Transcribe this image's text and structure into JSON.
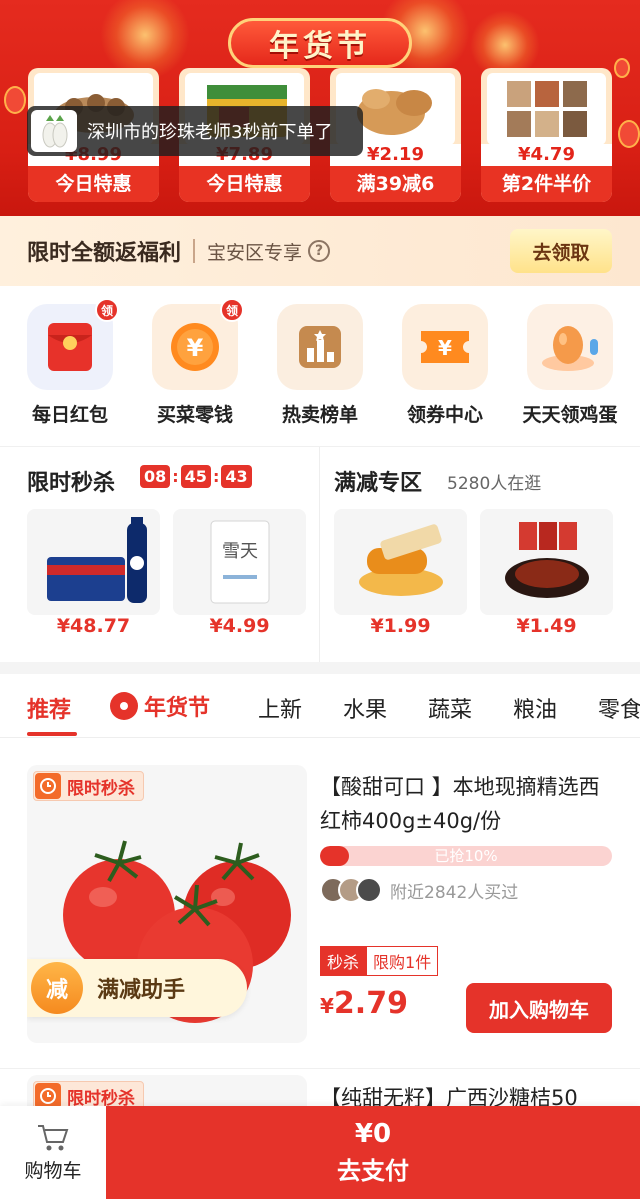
{
  "banner": {
    "title": "年货节",
    "deals": [
      {
        "price": "¥8.99",
        "tag": "今日特惠"
      },
      {
        "price": "¥7.89",
        "tag": "今日特惠"
      },
      {
        "price": "¥2.19",
        "tag": "满39减6"
      },
      {
        "price": "¥4.79",
        "tag": "第2件半价"
      }
    ],
    "toast": "深圳市的珍珠老师3秒前下单了"
  },
  "benefit": {
    "title": "限时全额返福利",
    "subtitle": "宝安区专享",
    "help": "?",
    "claim_button": "去领取"
  },
  "icon_grid": [
    {
      "label": "每日红包",
      "badge": "领",
      "icon": "red-envelope-icon"
    },
    {
      "label": "买菜零钱",
      "badge": "领",
      "icon": "yen-coin-icon"
    },
    {
      "label": "热卖榜单",
      "badge": "",
      "icon": "ranking-podium-icon"
    },
    {
      "label": "领券中心",
      "badge": "",
      "icon": "coupon-icon"
    },
    {
      "label": "天天领鸡蛋",
      "badge": "",
      "icon": "egg-icon"
    }
  ],
  "flash_sale": {
    "title": "限时秒杀",
    "timer": [
      "08",
      "45",
      "43"
    ],
    "products": [
      {
        "price": "¥48.77",
        "image": "pepsi-bottles"
      },
      {
        "price": "¥4.99",
        "image": "salt-bag"
      }
    ]
  },
  "discount_zone": {
    "title": "满减专区",
    "visitors": "5280人在逛",
    "products": [
      {
        "price": "¥1.99",
        "image": "bread-loaf"
      },
      {
        "price": "¥1.49",
        "image": "spicy-snacks"
      }
    ]
  },
  "tabs": [
    "推荐",
    "年货节",
    "上新",
    "水果",
    "蔬菜",
    "粮油",
    "零食"
  ],
  "active_tab": "推荐",
  "product": {
    "flash_tag": "限时秒杀",
    "helper": "满减助手",
    "helper_badge": "减",
    "title": "【酸甜可口 】本地现摘精选西红柿400g±40g/份",
    "progress_text": "已抢10%",
    "progress_value": 0.1,
    "buyers_text": "附近2842人买过",
    "tag_sale": "秒杀",
    "tag_limit": "限购1件",
    "currency": "¥",
    "price": "2.79",
    "add_button": "加入购物车"
  },
  "product2": {
    "flash_tag": "限时秒杀",
    "title": "【纯甜无籽】广西沙糖桔50"
  },
  "bottom_bar": {
    "cart_label": "购物车",
    "total": "¥0",
    "pay_label": "去支付"
  },
  "colors": {
    "brand_red": "#e5332a",
    "banner_red": "#d81f14",
    "gold": "#ffd27a"
  }
}
